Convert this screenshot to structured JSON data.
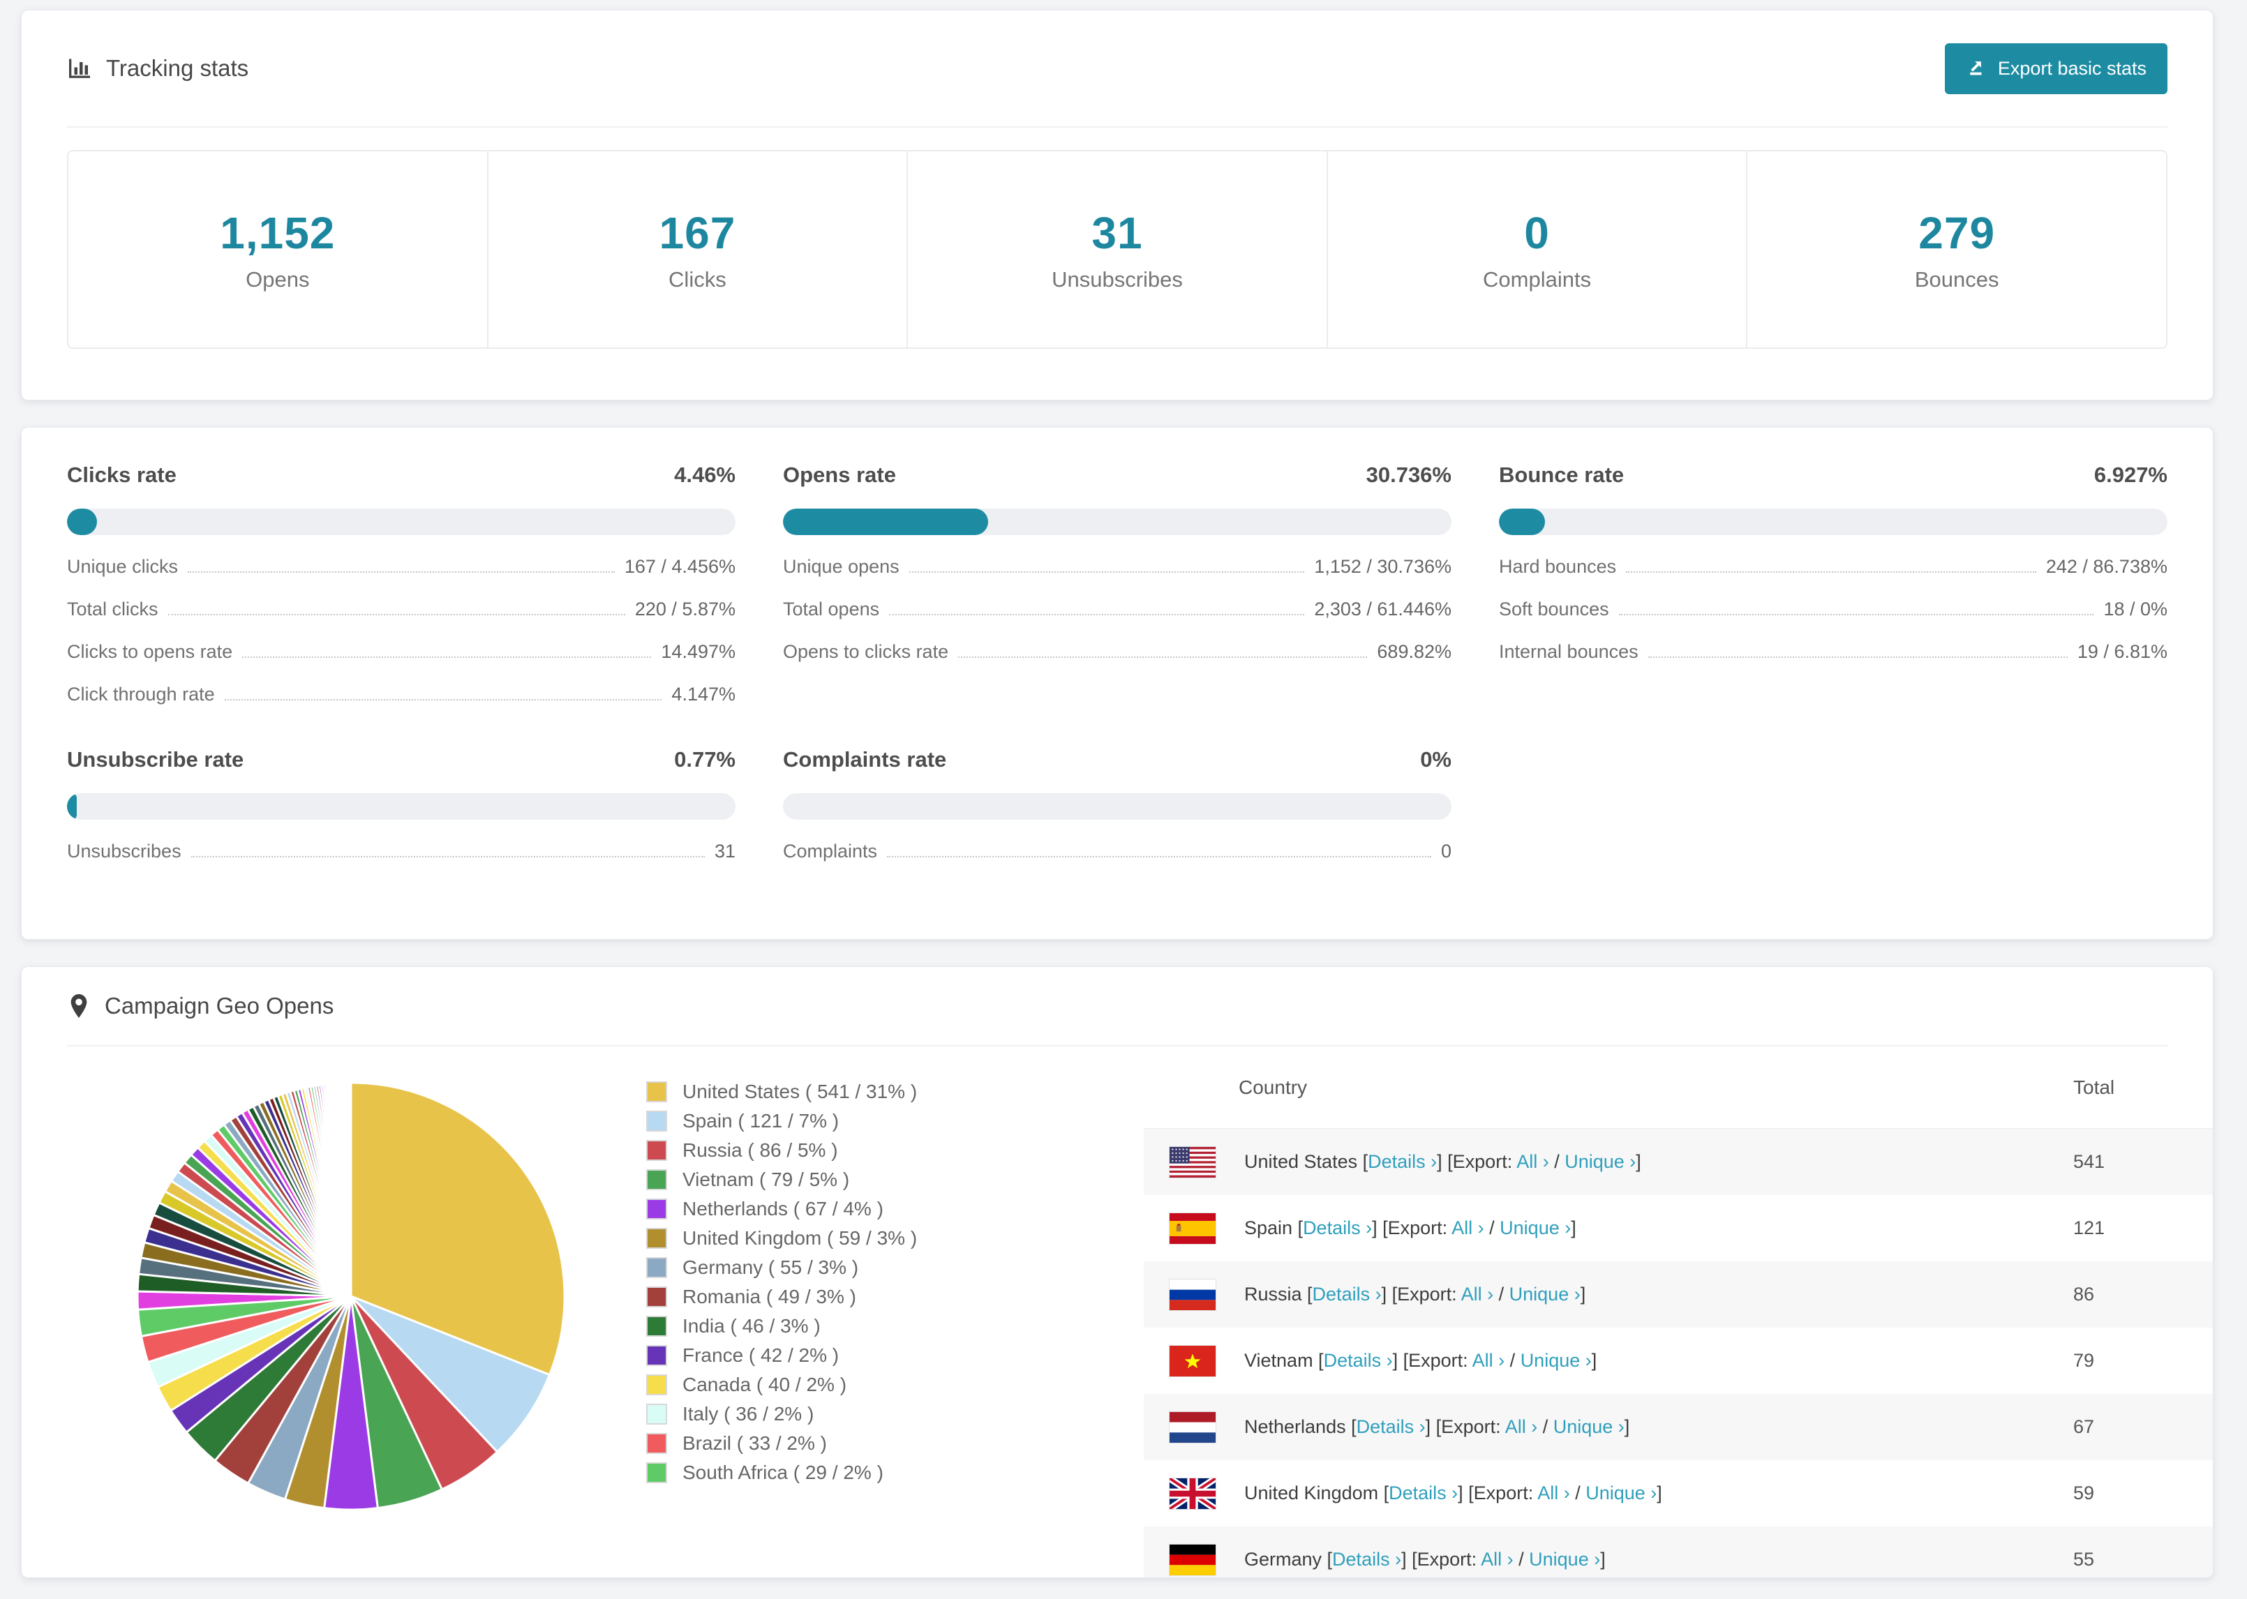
{
  "colors": {
    "accent": "#1d8ca3",
    "number": "#1d87a0",
    "link": "#2f9fbc"
  },
  "tracking": {
    "title": "Tracking stats",
    "export_button": "Export basic stats"
  },
  "stats": [
    {
      "value": "1,152",
      "label": "Opens"
    },
    {
      "value": "167",
      "label": "Clicks"
    },
    {
      "value": "31",
      "label": "Unsubscribes"
    },
    {
      "value": "0",
      "label": "Complaints"
    },
    {
      "value": "279",
      "label": "Bounces"
    }
  ],
  "rate_blocks": [
    {
      "id": "clicks",
      "title": "Clicks rate",
      "percent_label": "4.46%",
      "percent": 4.46,
      "rows": [
        {
          "label": "Unique clicks",
          "value": "167 / 4.456%"
        },
        {
          "label": "Total clicks",
          "value": "220 / 5.87%"
        },
        {
          "label": "Clicks to opens rate",
          "value": "14.497%"
        },
        {
          "label": "Click through rate",
          "value": "4.147%"
        }
      ]
    },
    {
      "id": "opens",
      "title": "Opens rate",
      "percent_label": "30.736%",
      "percent": 30.736,
      "rows": [
        {
          "label": "Unique opens",
          "value": "1,152 / 30.736%"
        },
        {
          "label": "Total opens",
          "value": "2,303 / 61.446%"
        },
        {
          "label": "Opens to clicks rate",
          "value": "689.82%"
        }
      ]
    },
    {
      "id": "bounce",
      "title": "Bounce rate",
      "percent_label": "6.927%",
      "percent": 6.927,
      "rows": [
        {
          "label": "Hard bounces",
          "value": "242 / 86.738%"
        },
        {
          "label": "Soft bounces",
          "value": "18 / 0%"
        },
        {
          "label": "Internal bounces",
          "value": "19 / 6.81%"
        }
      ]
    },
    {
      "id": "unsubscribe",
      "title": "Unsubscribe rate",
      "percent_label": "0.77%",
      "percent": 0.77,
      "rows": [
        {
          "label": "Unsubscribes",
          "value": "31"
        }
      ]
    },
    {
      "id": "complaints",
      "title": "Complaints rate",
      "percent_label": "0%",
      "percent": 0,
      "rows": [
        {
          "label": "Complaints",
          "value": "0"
        }
      ]
    }
  ],
  "geo": {
    "title": "Campaign Geo Opens",
    "legend": [
      {
        "label": "United States ( 541 / 31% )",
        "color": "#e8c34a"
      },
      {
        "label": "Spain ( 121 / 7% )",
        "color": "#b7d9f1"
      },
      {
        "label": "Russia ( 86 / 5% )",
        "color": "#cc4a50"
      },
      {
        "label": "Vietnam ( 79 / 5% )",
        "color": "#49a453"
      },
      {
        "label": "Netherlands ( 67 / 4% )",
        "color": "#9b3be5"
      },
      {
        "label": "United Kingdom ( 59 / 3% )",
        "color": "#b28f2e"
      },
      {
        "label": "Germany ( 55 / 3% )",
        "color": "#8ba9c2"
      },
      {
        "label": "Romania ( 49 / 3% )",
        "color": "#a2403c"
      },
      {
        "label": "India ( 46 / 3% )",
        "color": "#2e7a37"
      },
      {
        "label": "France ( 42 / 2% )",
        "color": "#6734b8"
      },
      {
        "label": "Canada ( 40 / 2% )",
        "color": "#f6dd4b"
      },
      {
        "label": "Italy ( 36 / 2% )",
        "color": "#dafcf6"
      },
      {
        "label": "Brazil ( 33 / 2% )",
        "color": "#f05c5e"
      },
      {
        "label": "South Africa ( 29 / 2% )",
        "color": "#5fcb67"
      }
    ],
    "table": {
      "col_country": "Country",
      "col_total": "Total",
      "details_label": "Details ›",
      "export_prefix": "Export:",
      "all_label": "All ›",
      "unique_label": "Unique ›",
      "rows": [
        {
          "flag": "us",
          "country": "United States",
          "total": "541"
        },
        {
          "flag": "es",
          "country": "Spain",
          "total": "121"
        },
        {
          "flag": "ru",
          "country": "Russia",
          "total": "86"
        },
        {
          "flag": "vn",
          "country": "Vietnam",
          "total": "79"
        },
        {
          "flag": "nl",
          "country": "Netherlands",
          "total": "67"
        },
        {
          "flag": "gb",
          "country": "United Kingdom",
          "total": "59"
        },
        {
          "flag": "de",
          "country": "Germany",
          "total": "55"
        }
      ]
    }
  },
  "chart_data": {
    "type": "pie",
    "title": "Campaign Geo Opens",
    "unit": "opens",
    "legend_position": "right",
    "slices": [
      {
        "name": "United States",
        "opens": 541,
        "pct": 31,
        "color": "#e8c34a"
      },
      {
        "name": "Spain",
        "opens": 121,
        "pct": 7,
        "color": "#b7d9f1"
      },
      {
        "name": "Russia",
        "opens": 86,
        "pct": 5,
        "color": "#cc4a50"
      },
      {
        "name": "Vietnam",
        "opens": 79,
        "pct": 5,
        "color": "#49a453"
      },
      {
        "name": "Netherlands",
        "opens": 67,
        "pct": 4,
        "color": "#9b3be5"
      },
      {
        "name": "United Kingdom",
        "opens": 59,
        "pct": 3,
        "color": "#b28f2e"
      },
      {
        "name": "Germany",
        "opens": 55,
        "pct": 3,
        "color": "#8ba9c2"
      },
      {
        "name": "Romania",
        "opens": 49,
        "pct": 3,
        "color": "#a2403c"
      },
      {
        "name": "India",
        "opens": 46,
        "pct": 3,
        "color": "#2e7a37"
      },
      {
        "name": "France",
        "opens": 42,
        "pct": 2,
        "color": "#6734b8"
      },
      {
        "name": "Canada",
        "opens": 40,
        "pct": 2,
        "color": "#f6dd4b"
      },
      {
        "name": "Italy",
        "opens": 36,
        "pct": 2,
        "color": "#dafcf6"
      },
      {
        "name": "Brazil",
        "opens": 33,
        "pct": 2,
        "color": "#f05c5e"
      },
      {
        "name": "South Africa",
        "opens": 29,
        "pct": 2,
        "color": "#5fcb67"
      }
    ],
    "others_tail": {
      "percent": 26,
      "count": 60,
      "decay": 0.95,
      "palette": [
        "#e23fe0",
        "#1f5d27",
        "#56707e",
        "#8a6d1f",
        "#3b2f8f",
        "#7a1f1f",
        "#174d3e",
        "#d8c928",
        "#e8c34a",
        "#b7d9f1",
        "#cc4a50",
        "#49a453",
        "#9b3be5",
        "#f6dd4b",
        "#dafcf6",
        "#f05c5e",
        "#5fcb67",
        "#8ba9c2",
        "#a2403c",
        "#6734b8"
      ]
    }
  }
}
